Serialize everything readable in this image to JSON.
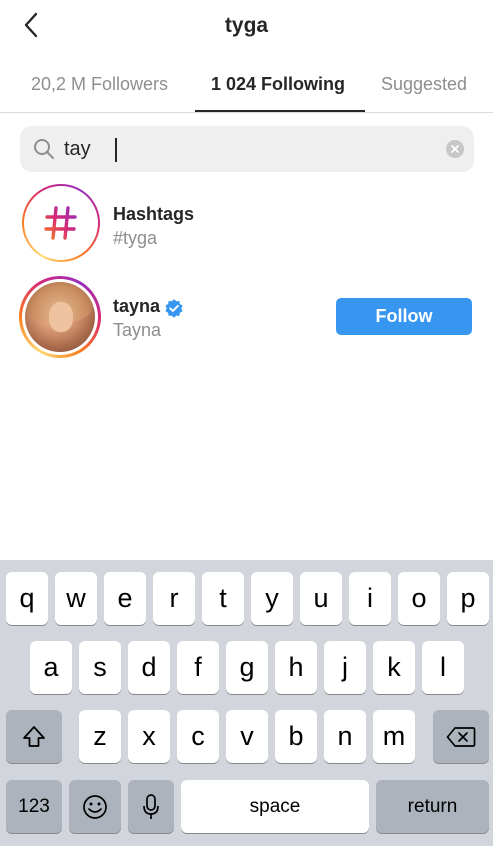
{
  "header": {
    "title": "tyga",
    "back_icon": "chevron-left-icon"
  },
  "tabs": [
    {
      "label": "20,2 M Followers",
      "active": false
    },
    {
      "label": "1 024 Following",
      "active": true
    },
    {
      "label": "Suggested",
      "active": false
    }
  ],
  "search": {
    "value": "tay",
    "icon": "search-icon",
    "clear_icon": "clear-icon"
  },
  "results": {
    "hashtag": {
      "title": "Hashtags",
      "subtitle": "#tyga",
      "icon": "hashtag-icon"
    },
    "user": {
      "username": "tayna",
      "name": "Tayna",
      "verified": true,
      "follow_label": "Follow"
    }
  },
  "keyboard": {
    "row1": [
      "q",
      "w",
      "e",
      "r",
      "t",
      "y",
      "u",
      "i",
      "o",
      "p"
    ],
    "row2": [
      "a",
      "s",
      "d",
      "f",
      "g",
      "h",
      "j",
      "k",
      "l"
    ],
    "row3": [
      "z",
      "x",
      "c",
      "v",
      "b",
      "n",
      "m"
    ],
    "numbers_label": "123",
    "space_label": "space",
    "return_label": "return",
    "shift_icon": "shift-icon",
    "delete_icon": "delete-icon",
    "emoji_icon": "emoji-icon",
    "mic_icon": "microphone-icon"
  },
  "colors": {
    "accent": "#3797f0",
    "verified": "#3797f0",
    "keyboard_bg": "#d2d5db"
  }
}
